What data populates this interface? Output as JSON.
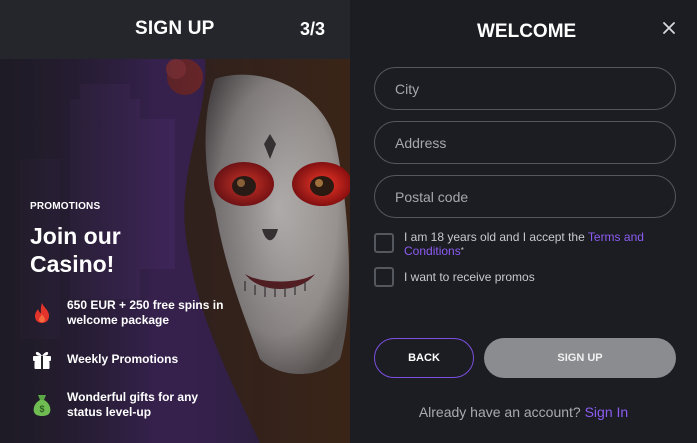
{
  "signup": {
    "title": "SIGN UP",
    "step": "3/3"
  },
  "promo": {
    "label": "PROMOTIONS",
    "heading": "Join our Casino!",
    "benefits": [
      {
        "icon": "fire-icon",
        "text": "650 EUR + 250 free spins in welcome package"
      },
      {
        "icon": "gift-icon",
        "text": "Weekly Promotions"
      },
      {
        "icon": "money-bag-icon",
        "text": "Wonderful gifts for any status level-up"
      }
    ],
    "art": "sugar-skull-portrait"
  },
  "form": {
    "title": "WELCOME",
    "close_icon": "close-icon",
    "fields": {
      "city": {
        "placeholder": "City",
        "value": ""
      },
      "address": {
        "placeholder": "Address",
        "value": ""
      },
      "postal": {
        "placeholder": "Postal code",
        "value": ""
      }
    },
    "age_check": {
      "text": "I am 18 years old and I accept the ",
      "link": "Terms and Conditions",
      "required_mark": "*",
      "checked": false
    },
    "promo_check": {
      "text": "I want to receive promos",
      "checked": false
    },
    "back_label": "BACK",
    "signup_label": "SIGN UP",
    "footer_text": "Already have an account?",
    "signin_label": "Sign In"
  },
  "colors": {
    "accent": "#8c5cf2",
    "panel_dark": "#1c1d22",
    "panel_left": "#24262b",
    "button_disabled": "#8b8c8f"
  }
}
